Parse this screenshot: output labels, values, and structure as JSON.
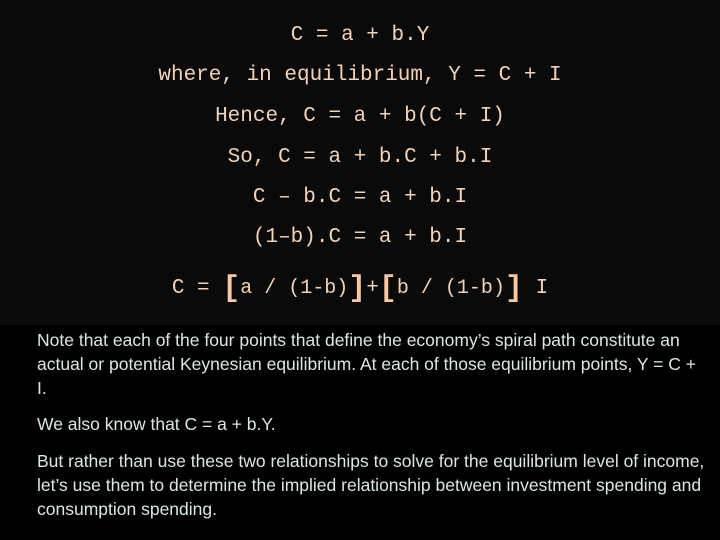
{
  "equations": [
    "C = a + b.Y",
    "where, in equilibrium, Y = C + I",
    "Hence, C = a + b(C + I)",
    "So, C = a + b.C + b.I",
    "C – b.C = a + b.I",
    "(1–b).C = a + b.I"
  ],
  "final_equation": {
    "lhs": "C = ",
    "open_bracket_1": "[",
    "term1": "a / (1-b)",
    "close_bracket_1": "]",
    "plus": "+",
    "open_bracket_2": "[",
    "term2": "b / (1-b)",
    "close_bracket_2": "]",
    "suffix": " I"
  },
  "notes": [
    "Note that each of the four points that define the economy’s spiral path constitute an actual or potential Keynesian equilibrium. At each of those equilibrium points, Y = C + I.",
    "We also know that C = a + b.Y.",
    "But rather than use these two relationships to solve for the equilibrium level of income, let’s use them to determine the implied relationship between investment spending and consumption spending."
  ],
  "colors": {
    "equation_text": "#f3d3b8",
    "bracket": "#f8c9a0",
    "note_text": "#dbe6e6",
    "top_background": "#0a0a0a",
    "bottom_background": "#000000"
  }
}
